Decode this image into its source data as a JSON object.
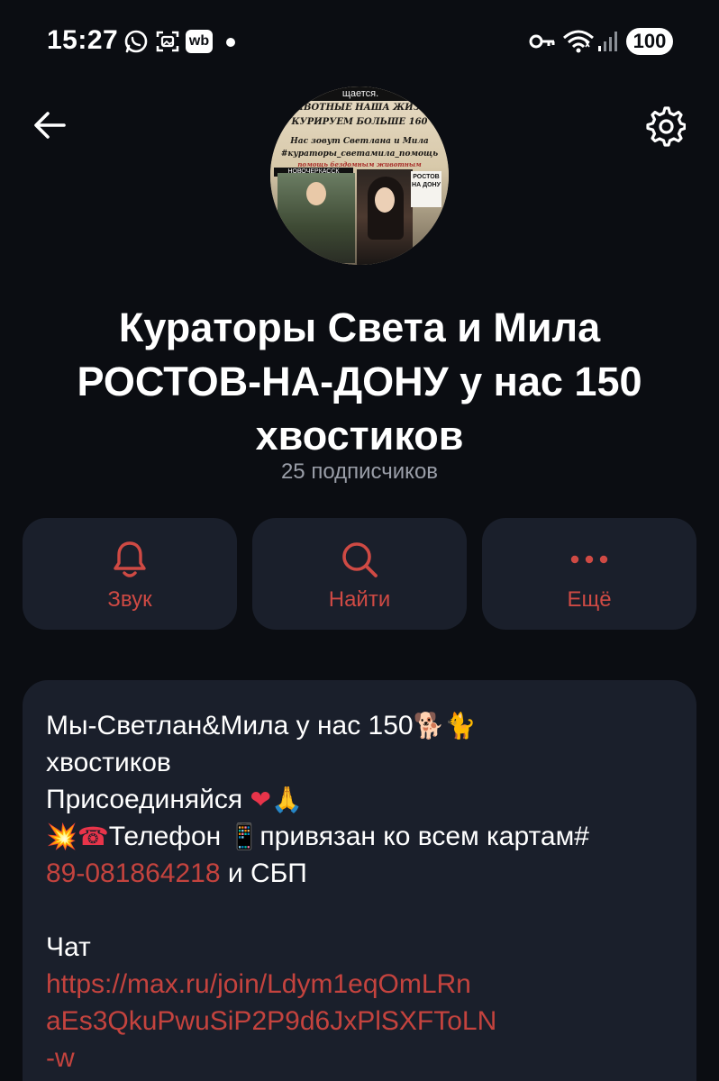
{
  "status_bar": {
    "time": "15:27",
    "battery": "100",
    "icons": [
      "whatsapp-icon",
      "screenshot-icon",
      "wb-icon",
      "key-icon",
      "wifi-icon",
      "signal-icon"
    ],
    "wb_label": "wb"
  },
  "nav": {
    "back_icon": "back-arrow-icon",
    "settings_icon": "gear-icon"
  },
  "avatar": {
    "lines": [
      "щается.",
      "ЖИВОТНЫЕ НАША ЖИЗНЬ",
      "КУРИРУЕМ БОЛЬШЕ 160",
      "Нас зовут Светлана и Мила",
      "#кураторы_светамила_помощь",
      "помощь бездомным животным"
    ],
    "tag_city": "НОВОЧЕРКАССК",
    "tag_sign": "РОСТОВ НА ДОНУ"
  },
  "channel": {
    "title": "Кураторы Света и Мила\nРОСТОВ-НА-ДОНУ  у нас 150\nхвостиков",
    "subscribers": "25 подписчиков"
  },
  "actions": [
    {
      "label": "Звук",
      "icon": "bell-icon"
    },
    {
      "label": "Найти",
      "icon": "search-icon"
    },
    {
      "label": "Ещё",
      "icon": "more-dots-icon"
    }
  ],
  "description": {
    "line1": "Мы-Светлан&Мила у нас  150",
    "line1_emoji": "🐕🐈",
    "line2": "хвостиков",
    "line3": "Присоединяйся",
    "line3_emoji": "❤🙏",
    "line4_emoji": "💥☎",
    "line4_a": "Телефон",
    "line4_emoji2": "📱",
    "line4_b": "привязан ко всем картам#",
    "phone": "89-081864218",
    "line5_after": " и СБП",
    "chat_label": "Чат",
    "chat_link_1": "https://max.ru/join/Ldym1eqOmLRn",
    "chat_link_2": "aEs3QkuPwuSiP2P9d6JxPlSXFToLN",
    "chat_link_3": "-w"
  },
  "colors": {
    "background": "#0b0d12",
    "card": "#1a1f2b",
    "accent": "#cf4a44",
    "muted": "#9a9ea8"
  }
}
